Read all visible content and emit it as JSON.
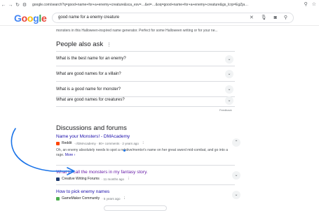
{
  "browser": {
    "url": "google.com/search?q=good+name+for+a+enemy+creature&sca_esv=…&ei=…&oq=good+name+for+a+enemy+creature&gs_lcrp=EgZja…"
  },
  "search": {
    "logo": "Google",
    "query": "good name for a enemy creature"
  },
  "top_snippet": "monsters in this Halloween-inspired name generator. Perfect for some Halloween writing or for your ne...",
  "paa": {
    "title": "People also ask",
    "questions": [
      "What is the best name for an enemy?",
      "What are good names for a villain?",
      "What is a good name for monster?",
      "What are good names for creatures?"
    ],
    "feedback": "Feedback"
  },
  "discussions": {
    "title": "Discussions and forums",
    "items": [
      {
        "title": "Name your Monsters! - DMAcademy",
        "site": "Reddit",
        "meta": "· r/DMAcademy · 80+ comments · 2 years ago",
        "snippet": "Oh, an enemy absolutely needs to spot a relative/mentor's name on her great sword mid-combat, and go into a rage.",
        "more": "More ›"
      },
      {
        "title": "What to call the monsters in my fantasy story.",
        "site": "Creative Writing Forums",
        "meta": "· 11 months ago"
      },
      {
        "title": "How to pick enemy names",
        "site": "GameMaker Community",
        "meta": "· 5 years ago"
      }
    ]
  },
  "colors": {
    "link": "#1a0dab",
    "visited": "#681da8",
    "annotation": "#1a73e8"
  }
}
